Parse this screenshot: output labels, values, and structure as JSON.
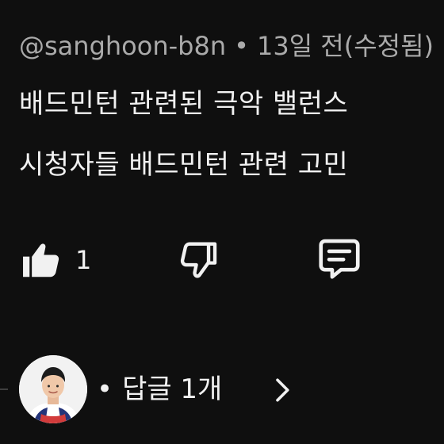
{
  "comment": {
    "author": "@sanghoon-b8n",
    "separator": "•",
    "timestamp": "13일 전(수정됨)",
    "line1": "배드민턴 관련된 극악 밸런스",
    "line2": "시청자들 배드민턴 관련 고민"
  },
  "actions": {
    "like_icon": "thumbs-up-filled-icon",
    "like_count": "1",
    "dislike_icon": "thumbs-down-outline-icon",
    "reply_icon": "comment-icon"
  },
  "replies": {
    "dot": "•",
    "label": "답글 1개",
    "chevron_icon": "chevron-right-icon"
  },
  "colors": {
    "background": "#0f0f0f",
    "primary_text": "#f1f1f1",
    "secondary_text": "#aaaaaa"
  }
}
